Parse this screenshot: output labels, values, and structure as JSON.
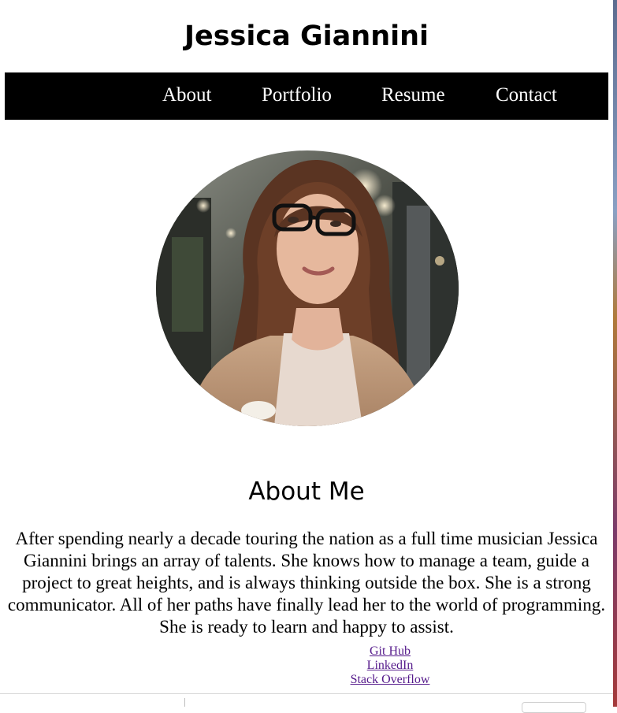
{
  "header": {
    "title": "Jessica Giannini"
  },
  "nav": {
    "items": [
      {
        "label": "About"
      },
      {
        "label": "Portfolio"
      },
      {
        "label": "Resume"
      },
      {
        "label": "Contact"
      }
    ]
  },
  "about": {
    "heading": "About Me",
    "text": "After spending nearly a decade touring the nation as a full time musician Jessica Giannini brings an array of talents. She knows how to manage a team, guide a project to great heights, and is always thinking outside the box. She is a strong communicator. All of her paths have finally lead her to the world of programming. She is ready to learn and happy to assist."
  },
  "links": [
    {
      "label": "Git Hub"
    },
    {
      "label": "LinkedIn"
    },
    {
      "label": "Stack Overflow"
    }
  ],
  "colors": {
    "nav_background": "#000000",
    "nav_text": "#ffffff",
    "visited_link": "#551a8b"
  }
}
